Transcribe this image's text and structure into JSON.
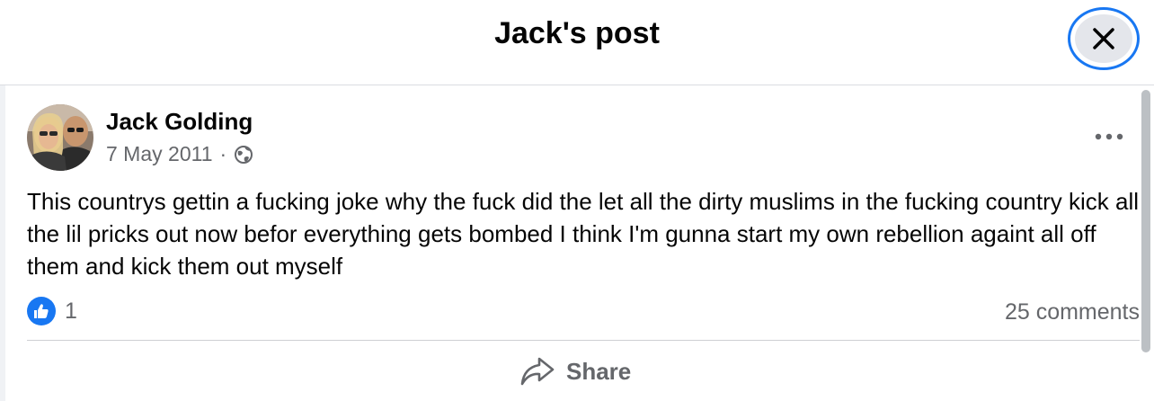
{
  "header": {
    "title": "Jack's post",
    "close_icon": "close-icon"
  },
  "post": {
    "author": "Jack Golding",
    "date": "7 May 2011",
    "separator": "·",
    "privacy_icon": "globe-icon",
    "more_icon": "more-options-icon",
    "text": "This countrys gettin a fucking joke why the fuck did the let all the dirty muslims in the fucking country kick all the lil pricks out now befor everything gets bombed I think I'm gunna start my own rebellion againt all off them and kick them out myself"
  },
  "stats": {
    "reaction_icon": "like-icon",
    "reaction_count": "1",
    "comments": "25 comments"
  },
  "actions": {
    "share_label": "Share",
    "share_icon": "share-icon"
  },
  "colors": {
    "accent": "#1877f2",
    "secondary_text": "#65676b",
    "primary_text": "#050505",
    "close_bg": "#e4e6eb"
  }
}
